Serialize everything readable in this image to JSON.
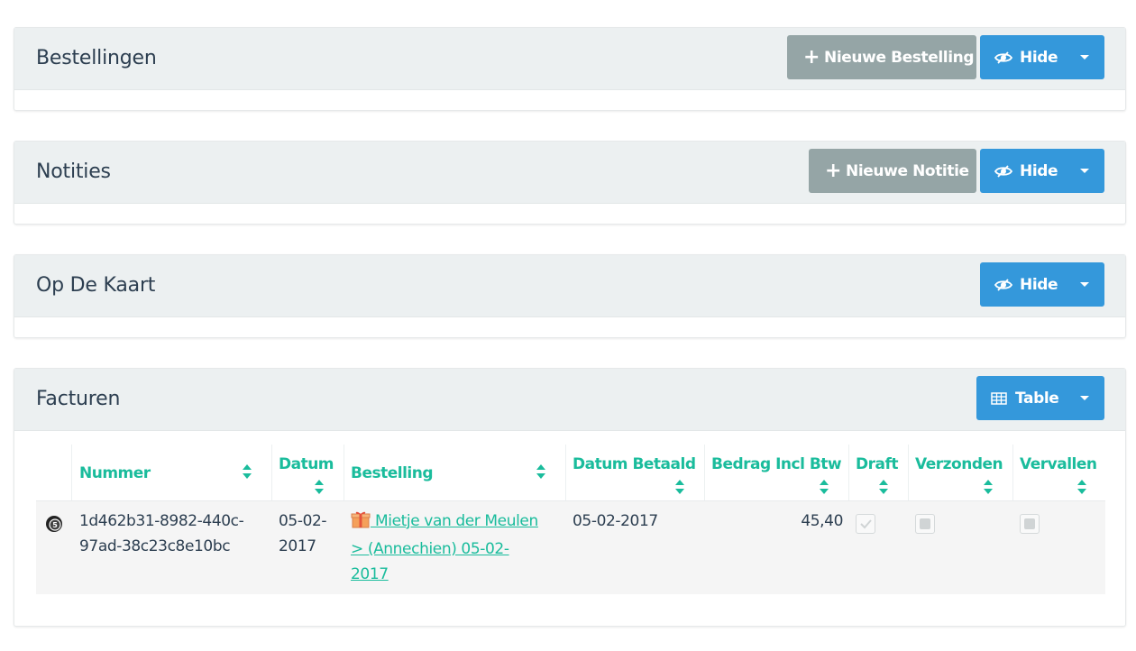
{
  "panels": {
    "bestellingen": {
      "title": "Bestellingen",
      "new_label": "Nieuwe Bestelling",
      "hide_label": "Hide"
    },
    "notities": {
      "title": "Notities",
      "new_label": "Nieuwe Notitie",
      "hide_label": "Hide"
    },
    "kaart": {
      "title": "Op De Kaart",
      "hide_label": "Hide"
    },
    "facturen": {
      "title": "Facturen",
      "view_label": "Table"
    }
  },
  "invoices": {
    "columns": {
      "nummer": "Nummer",
      "datum": "Datum",
      "bestelling": "Bestelling",
      "datum_betaald": "Datum Betaald",
      "bedrag": "Bedrag Incl Btw",
      "draft": "Draft",
      "verzonden": "Verzonden",
      "vervallen": "Vervallen"
    },
    "rows": [
      {
        "nummer_line1": "1d462b31-8982-440c-",
        "nummer_line2": "97ad-38c23c8e10bc",
        "datum_line1": "05-02-",
        "datum_line2": "2017",
        "bestelling_line1": " Mietje van der Meulen",
        "bestelling_line2": "> (Annechien) 05-02-",
        "bestelling_line3": "2017",
        "datum_betaald": "05-02-2017",
        "bedrag": "45,40",
        "draft": true,
        "verzonden": false,
        "vervallen": false
      }
    ]
  },
  "colors": {
    "accent": "#1abc9c",
    "primary": "#3498db",
    "muted": "#95a5a6",
    "heading_bg": "#ecf0f1"
  }
}
